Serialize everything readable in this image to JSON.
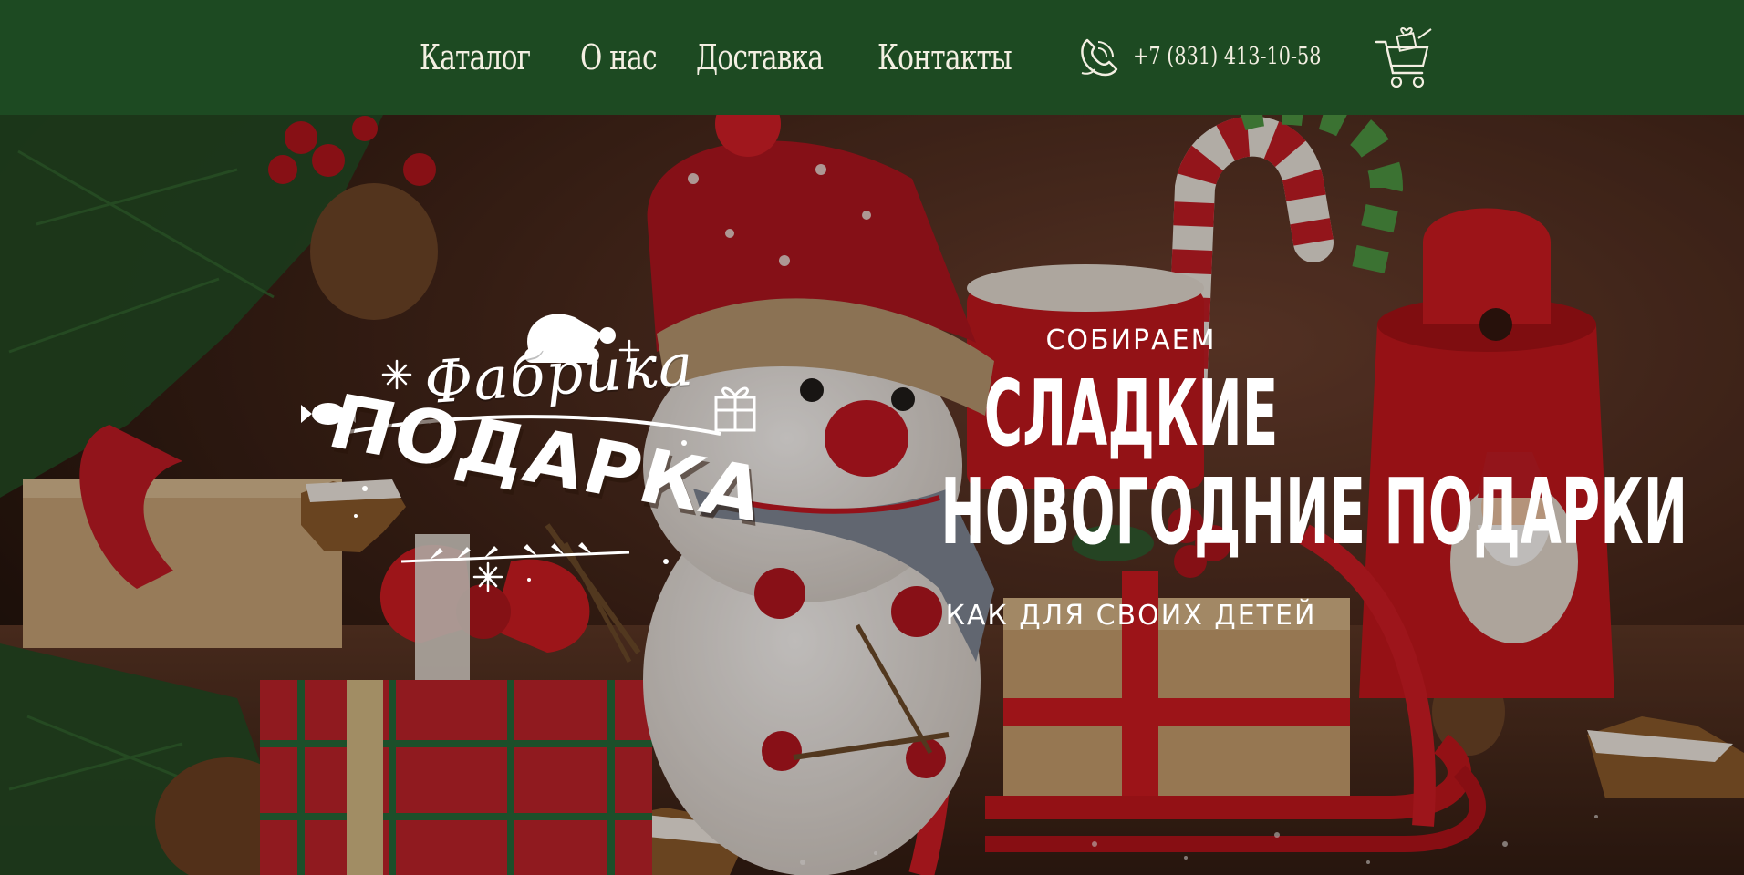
{
  "header": {
    "nav": [
      {
        "label": "Каталог"
      },
      {
        "label": "О нас"
      },
      {
        "label": "Доставка"
      },
      {
        "label": "Контакты"
      }
    ],
    "phone": "+7 (831) 413-10-58"
  },
  "logo": {
    "line1": "Фабрика",
    "line2": "ПОДАРКА"
  },
  "hero": {
    "subtitle_top": "СОБИРАЕМ",
    "title_line1": "СЛАДКИЕ",
    "title_line2": "НОВОГОДНИЕ ПОДАРКИ",
    "subtitle_bottom": "КАК ДЛЯ СВОИХ ДЕТЕЙ"
  },
  "colors": {
    "header_bg": "#1d4a22",
    "text": "#ffffff"
  }
}
